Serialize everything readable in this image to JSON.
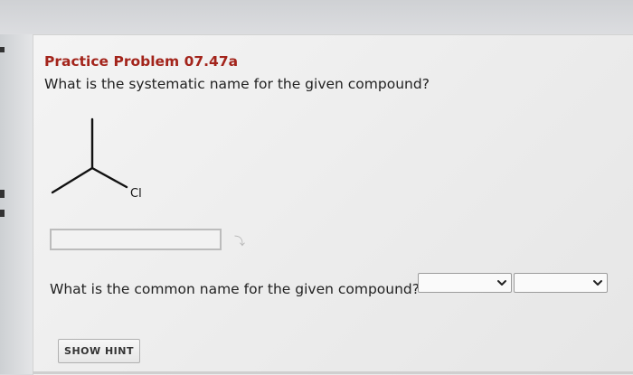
{
  "problem": {
    "title": "Practice Problem 07.47a",
    "question": "What is the systematic name for the given compound?",
    "structure_label": "Cl",
    "answer_value": "",
    "answer_hint_glyph": "⤵"
  },
  "common_name": {
    "question": "What is the common name for the given compound?",
    "dropdown_1_value": "",
    "dropdown_2_value": ""
  },
  "hint": {
    "button_label": "SHOW HINT"
  },
  "icons": {
    "dropdown_arrow": "chevron-down-icon"
  }
}
